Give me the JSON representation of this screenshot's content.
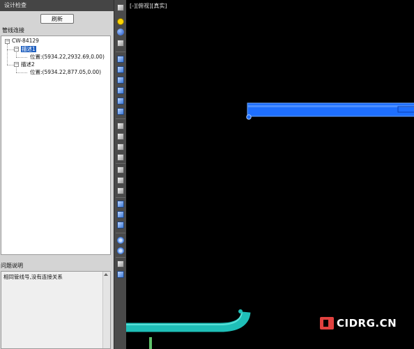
{
  "panel": {
    "title": "设计检查",
    "refresh_label": "刷新",
    "section_label": "管线连接",
    "tree": {
      "root": "CW-84129",
      "children": [
        {
          "label": "描述1",
          "position": "位置:(5934.22,2932.69,0.00)",
          "selected": true
        },
        {
          "label": "描述2",
          "position": "位置:(5934.22,877.05,0.00)",
          "selected": false
        }
      ]
    },
    "issue_label": "问题说明",
    "issue_text": "相同管线号,没有连接关系"
  },
  "viewport": {
    "label": "[-][俯视][真实]",
    "watermark": "CIDRG.CN"
  },
  "colors": {
    "pipe_blue": "#1e6fff",
    "pipe_teal": "#1fbfb8",
    "pipe_green": "#5fc26a",
    "selection": "#1f5fbf",
    "watermark_red": "#e0413f"
  },
  "toolbar_icons": [
    "window-icon",
    "sun-icon",
    "sphere-icon",
    "layers-icon",
    "view-front-icon",
    "view-back-icon",
    "view-left-icon",
    "view-right-icon",
    "view-top-icon",
    "view-bottom-icon",
    "iso-sw-icon",
    "iso-se-icon",
    "iso-ne-icon",
    "iso-nw-icon",
    "axis-icon",
    "orbit-icon",
    "pan-icon",
    "cube-wire-icon",
    "cube-solid-icon",
    "cube-section-icon",
    "eye-icon",
    "eye-hidden-icon",
    "box-icon",
    "box-open-icon"
  ]
}
